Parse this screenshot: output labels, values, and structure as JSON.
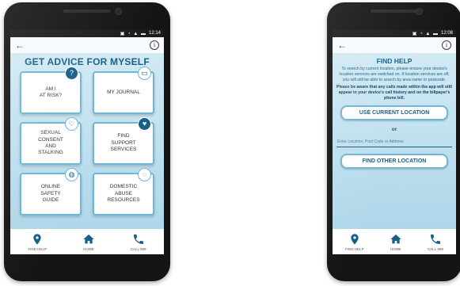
{
  "screen1": {
    "status_time": "12:14",
    "title": "GET ADVICE FOR MYSELF",
    "cards": [
      {
        "label": "AM I\nAT RISK?",
        "icon": "question-mark-icon",
        "badge": "?"
      },
      {
        "label": "MY JOURNAL",
        "icon": "book-icon",
        "badge": "▭"
      },
      {
        "label": "SEXUAL\nCONSENT\nAND\nSTALKING",
        "icon": "heart-outline-icon",
        "badge": "♡"
      },
      {
        "label": "FIND\nSUPPORT\nSERVICES",
        "icon": "heart-filled-icon",
        "badge": "♥"
      },
      {
        "label": "ONLINE\nSAFETY\nGUIDE",
        "icon": "globe-icon",
        "badge": "◍"
      },
      {
        "label": "DOMESTIC\nABUSE\nRESOURCES",
        "icon": "chat-bubbles-icon",
        "badge": "◌"
      }
    ]
  },
  "screen2": {
    "status_time": "12:08",
    "title": "FIND HELP",
    "body": "To search by current location, please ensure your device's location services are switched on. If location services are off, you will still be able to search by area name or postcode.",
    "warning": "Please be aware that any calls made within the app will still appear in your device's call history and on the billpayer's phone bill.",
    "use_current_location": "USE CURRENT LOCATION",
    "or": "or",
    "location_placeholder": "Enter Location, Post Code or Address",
    "find_other_location": "FIND OTHER LOCATION"
  },
  "nav": {
    "find_help": "FIND HELP",
    "home": "HOME",
    "call": "CALL 999"
  },
  "colors": {
    "brand": "#185e86",
    "card_border": "#6fb6d8",
    "background_top": "#d6ecf5",
    "background_bottom": "#a9d4e8"
  }
}
